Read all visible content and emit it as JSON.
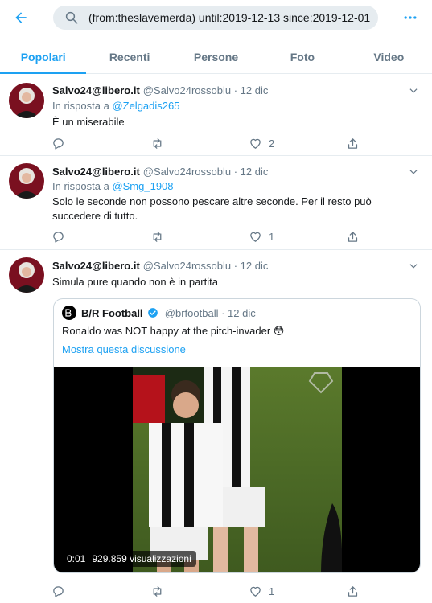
{
  "search": {
    "query": "(from:theslavemerda) until:2019-12-13 since:2019-12-01"
  },
  "tabs": [
    {
      "label": "Popolari",
      "active": true
    },
    {
      "label": "Recenti"
    },
    {
      "label": "Persone"
    },
    {
      "label": "Foto"
    },
    {
      "label": "Video"
    }
  ],
  "colors": {
    "accent": "#1da1f2",
    "muted": "#657786",
    "text": "#14171a"
  },
  "tweets": [
    {
      "name": "Salvo24@libero.it",
      "meta": "@Salvo24rossoblu · 12 dic",
      "reply_prefix": "In risposta a ",
      "reply_to": "@Zelgadis265",
      "text": "È un miserabile",
      "likes": "2"
    },
    {
      "name": "Salvo24@libero.it",
      "meta": "@Salvo24rossoblu · 12 dic",
      "reply_prefix": "In risposta a ",
      "reply_to": "@Smg_1908",
      "text": "Solo le seconde non possono pescare altre seconde. Per il resto può succedere di tutto.",
      "likes": "1"
    },
    {
      "name": "Salvo24@libero.it",
      "meta": "@Salvo24rossoblu · 12 dic",
      "text": "Simula pure quando non è in partita",
      "likes": "1",
      "quote": {
        "name": "B/R Football",
        "meta": "@brfootball · 12 dic",
        "text": "Ronaldo was NOT happy at the pitch-invader 😳",
        "link": "Mostra questa discussione",
        "video": {
          "time": "0:01",
          "views": "929.859 visualizzazioni"
        }
      }
    }
  ]
}
